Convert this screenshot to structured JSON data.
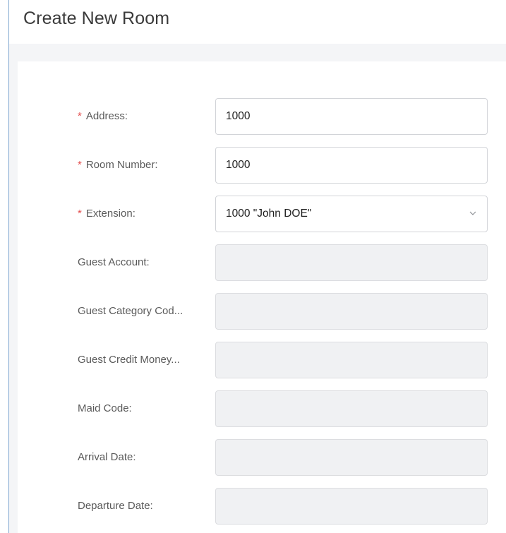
{
  "page": {
    "title": "Create New Room"
  },
  "form": {
    "address": {
      "label": "Address:",
      "value": "1000",
      "required": true
    },
    "room_number": {
      "label": "Room Number:",
      "value": "1000",
      "required": true
    },
    "extension": {
      "label": "Extension:",
      "value": "1000 \"John DOE\"",
      "required": true
    },
    "guest_account": {
      "label": "Guest Account:",
      "value": ""
    },
    "guest_category_code": {
      "label": "Guest Category Cod...",
      "value": ""
    },
    "guest_credit_money": {
      "label": "Guest Credit Money...",
      "value": ""
    },
    "maid_code": {
      "label": "Maid Code:",
      "value": ""
    },
    "arrival_date": {
      "label": "Arrival Date:",
      "value": ""
    },
    "departure_date": {
      "label": "Departure Date:",
      "value": ""
    }
  },
  "colors": {
    "required_marker": "#e34d4d",
    "input_border": "#d2d4d8",
    "disabled_background": "#f0f1f3",
    "panel_background": "#f4f5f7"
  },
  "icons": {
    "extension_dropdown": "chevron-down-icon"
  }
}
